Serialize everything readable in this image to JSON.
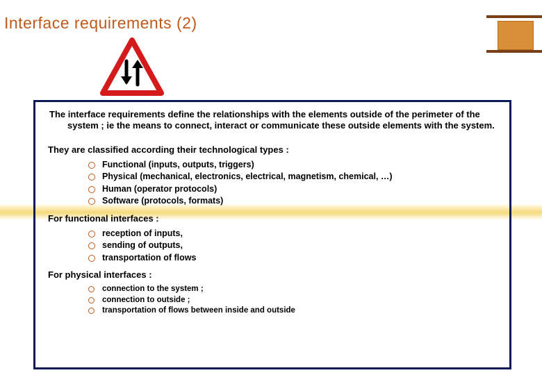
{
  "title": "Interface requirements (2)",
  "sign": {
    "name": "warning-triangle-two-way-arrows"
  },
  "intro": "The interface requirements define the relationships with the elements outside of the perimeter of the system ; ie the means to connect, interact or communicate these outside elements with the system.",
  "sections": [
    {
      "heading": "They are classified according their technological types :",
      "items": [
        "Functional (inputs, outputs, triggers)",
        "Physical (mechanical, electronics, electrical, magnetism, chemical, …)",
        "Human (operator protocols)",
        "Software (protocols, formats)"
      ],
      "small": false
    },
    {
      "heading": "For functional interfaces :",
      "items": [
        "reception of inputs,",
        "sending of outputs,",
        "transportation of flows"
      ],
      "small": false
    },
    {
      "heading": "For physical interfaces :",
      "items": [
        "connection to the system ;",
        "connection to outside ;",
        "transportation of flows between inside and outside"
      ],
      "small": true
    }
  ]
}
